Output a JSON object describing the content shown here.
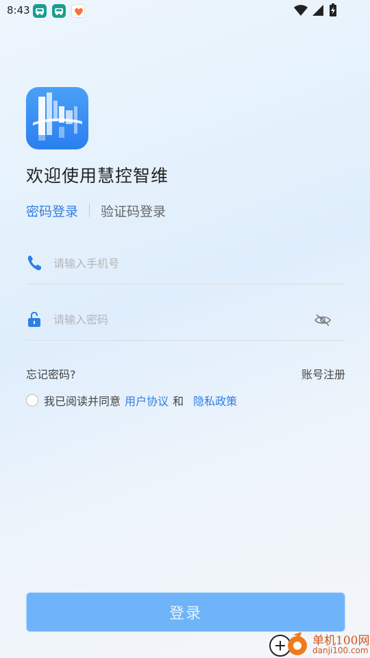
{
  "status_bar": {
    "time": "8:43",
    "notification_icons": [
      "car-app-icon",
      "car-app-icon",
      "heart-app-icon"
    ],
    "system_icons": [
      "wifi-icon",
      "signal-icon",
      "battery-icon"
    ]
  },
  "app": {
    "logo_icon": "building-logo-icon",
    "welcome": "欢迎使用慧控智维"
  },
  "login_tabs": {
    "password_login": "密码登录",
    "sms_login": "验证码登录",
    "active": "password_login"
  },
  "phone_field": {
    "placeholder": "请输入手机号",
    "value": "",
    "icon": "phone-icon"
  },
  "password_field": {
    "placeholder": "请输入密码",
    "value": "",
    "icon": "lock-icon",
    "toggle_icon": "eye-hidden-icon"
  },
  "links": {
    "forgot_password": "忘记密码?",
    "register": "账号注册"
  },
  "agreement": {
    "prefix": "我已阅读并同意",
    "user_agreement": "用户协议",
    "and": "和",
    "privacy_policy": "隐私政策",
    "checked": false
  },
  "login_button": {
    "label": "登录"
  },
  "watermark": {
    "site_name": "单机100网",
    "url": "danji100.com"
  },
  "colors": {
    "accent": "#2e7fe3",
    "button_disabled": "#6fb4f8",
    "watermark": "#d2571b"
  }
}
